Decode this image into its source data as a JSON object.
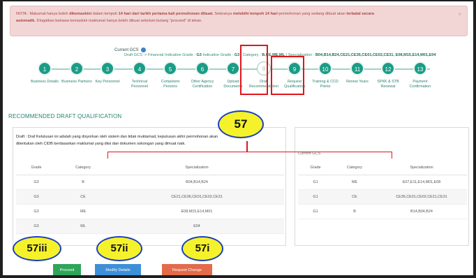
{
  "alert": {
    "line1_a": "NOTA : Makumat hanya boleh ",
    "line1_b": "dikemaskini",
    "line1_c": " dalam tempoh ",
    "line1_d": "14 hari dari tarikh pertama kali permohonan dibuat.",
    "line1_e": " Sekiranya ",
    "line1_f": "melebihi tempoh 14 hari",
    "line1_g": " permohonan yang sedang dibuat akan ",
    "line1_h": "terbatal secara",
    "line2_a": "automatik.",
    "line2_b": " Dingatkan bahawa kemaskini maklumat hanya boleh dibuat sebelum butang \"proceed\" di tekan.",
    "close": "×"
  },
  "gcs": {
    "current_label": "Current GCS",
    "info_prefix": "Draft GCS -> Financial Indicative Grade : ",
    "grade": "G3",
    "indicative_label": " Indicative Grade : ",
    "grade2": "G3",
    "category_label": " | Category : ",
    "category": "B,CE,ME,ML",
    "spec_label": " | Specialization : ",
    "spec": "B04,B14,B24,CE21,CE36,CE01,CE02,CE31, E08,M15,E14,M01,E04"
  },
  "steps": [
    {
      "num": "1",
      "label": "Business Details"
    },
    {
      "num": "2",
      "label": "Business Partners"
    },
    {
      "num": "3",
      "label": "Key Personnel"
    },
    {
      "num": "4",
      "label": "Technical Personnel"
    },
    {
      "num": "5",
      "label": "Competent Persons"
    },
    {
      "num": "6",
      "label": "Other Agency Certification"
    },
    {
      "num": "7",
      "label": "Upload Documents"
    },
    {
      "num": "8",
      "label": "Draft Recommendation"
    },
    {
      "num": "9",
      "label": "Request Qualification"
    },
    {
      "num": "10",
      "label": "Training & CCD Points"
    },
    {
      "num": "11",
      "label": "Renew Years"
    },
    {
      "num": "12",
      "label": "SPKK & STB Renewal"
    },
    {
      "num": "13",
      "label": "Payment Confirmation"
    }
  ],
  "section_title": "RECOMMENDED DRAFT QUALIFICATION",
  "draft_note": "Draft : Draf Kelulusan ini adalah yang disyorkan oleh sistem dan tidak muktamad, keputusan akhir permohonan akan ditentukan oleh CIDB berdasarkan maklumat yang diisi dan dokumen sokongan yang dimuat naik.",
  "left_table": {
    "headers": [
      "Grade",
      "Category",
      "Specialization"
    ],
    "rows": [
      [
        "G3",
        "B",
        "B04,B14,B24"
      ],
      [
        "G3",
        "CE",
        "CE21,CE36,CE01,CE02,CE31"
      ],
      [
        "G3",
        "ME",
        "E08,M15,E14,M01"
      ],
      [
        "G3",
        "ML",
        "E04"
      ]
    ]
  },
  "right_panel": {
    "title": "Current GCS",
    "headers": [
      "Grade",
      "Category",
      "Specialization"
    ],
    "rows": [
      [
        "G1",
        "ME",
        "E07,E11,E14,M01,E08"
      ],
      [
        "G1",
        "CE",
        "CE36,CE01,CE02,CE21,CE31"
      ],
      [
        "G1",
        "B",
        "B14,B04,B24"
      ]
    ]
  },
  "annotations": {
    "a57": "57",
    "a57iii": "57iii",
    "a57ii": "57ii",
    "a57i": "57i"
  },
  "buttons": {
    "proceed": "Proceed",
    "modify": "Modify Details",
    "request_change": "Request Change"
  },
  "colors": {
    "accent": "#1b9c86",
    "alert_bg": "#f2d6d6",
    "annotation_red": "#e0151a",
    "oval_fill": "#f5f22b",
    "oval_border": "#1a3fbf"
  }
}
